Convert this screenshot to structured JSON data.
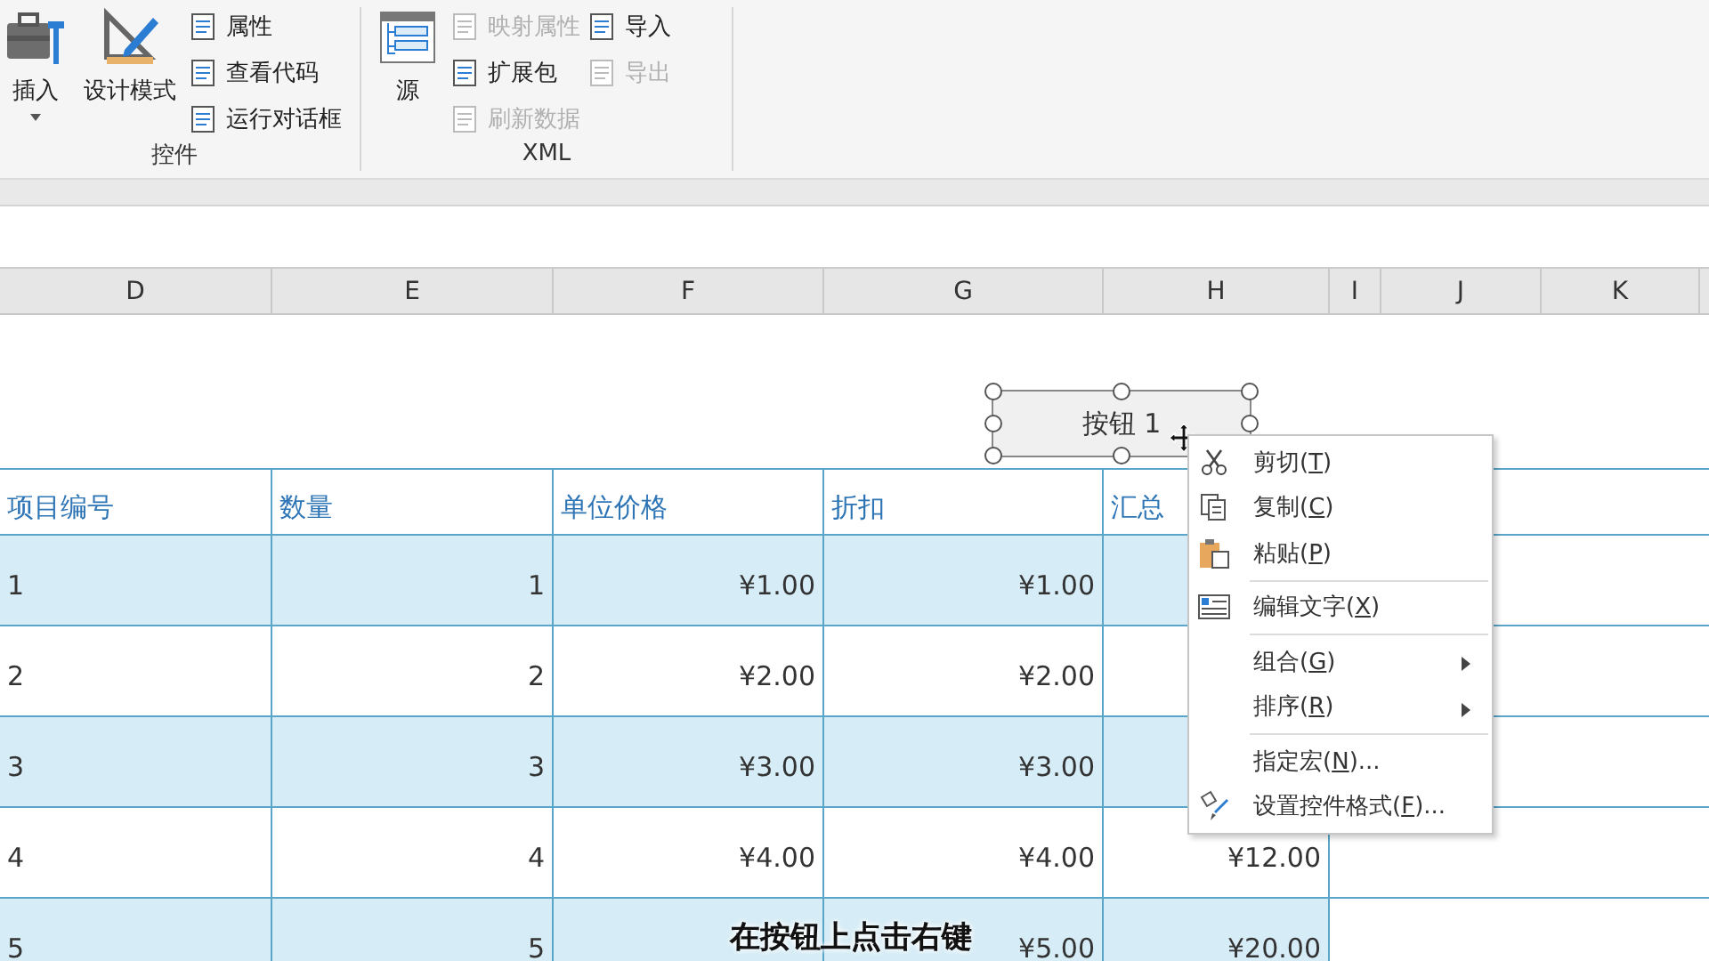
{
  "ribbon": {
    "groups": [
      {
        "label": "控件",
        "items": [
          {
            "kind": "large",
            "label": "插入",
            "dropdown": true,
            "disabled": false
          },
          {
            "kind": "large",
            "label": "设计模式",
            "disabled": false
          },
          {
            "kind": "stack",
            "items": [
              {
                "label": "属性",
                "disabled": false
              },
              {
                "label": "查看代码",
                "disabled": false
              },
              {
                "label": "运行对话框",
                "disabled": false
              }
            ]
          }
        ]
      },
      {
        "label": "XML",
        "items": [
          {
            "kind": "large",
            "label": "源",
            "disabled": false
          },
          {
            "kind": "stack",
            "items": [
              {
                "label": "映射属性",
                "disabled": true
              },
              {
                "label": "扩展包",
                "disabled": false
              },
              {
                "label": "刷新数据",
                "disabled": true
              }
            ]
          },
          {
            "kind": "stack",
            "items": [
              {
                "label": "导入",
                "disabled": false
              },
              {
                "label": "导出",
                "disabled": true
              }
            ]
          }
        ]
      }
    ]
  },
  "column_headers": [
    "D",
    "E",
    "F",
    "G",
    "H",
    "I",
    "J",
    "K"
  ],
  "table": {
    "columns": [
      "项目编号",
      "数量",
      "单位价格",
      "折扣",
      "汇总"
    ],
    "rows": [
      {
        "item": "1",
        "qty": "1",
        "price": "¥1.00",
        "discount": "¥1.00"
      },
      {
        "item": "2",
        "qty": "2",
        "price": "¥2.00",
        "discount": "¥2.00"
      },
      {
        "item": "3",
        "qty": "3",
        "price": "¥3.00",
        "discount": "¥3.00"
      },
      {
        "item": "4",
        "qty": "4",
        "price": "¥4.00",
        "discount": "¥4.00",
        "total": "¥12.00"
      },
      {
        "item": "5",
        "qty": "5",
        "discount": "¥5.00",
        "total": "¥20.00"
      }
    ]
  },
  "form_button": {
    "label": "按钮 1",
    "selected": true
  },
  "context_menu": [
    {
      "kind": "item",
      "text": "剪切(",
      "key": "T",
      "rest": ")"
    },
    {
      "kind": "item",
      "text": "复制(",
      "key": "C",
      "rest": ")"
    },
    {
      "kind": "item",
      "text": "粘贴(",
      "key": "P",
      "rest": ")"
    },
    {
      "kind": "separator"
    },
    {
      "kind": "item",
      "text": "编辑文字(",
      "key": "X",
      "rest": ")"
    },
    {
      "kind": "separator"
    },
    {
      "kind": "item",
      "text": "组合(",
      "key": "G",
      "rest": ")",
      "submenu": true
    },
    {
      "kind": "item",
      "text": "排序(",
      "key": "R",
      "rest": ")",
      "submenu": true
    },
    {
      "kind": "separator"
    },
    {
      "kind": "item",
      "text": "指定宏(",
      "key": "N",
      "rest": ")..."
    },
    {
      "kind": "item",
      "text": "设置控件格式(",
      "key": "F",
      "rest": ")..."
    }
  ],
  "caption": "在按钮上点击右键"
}
